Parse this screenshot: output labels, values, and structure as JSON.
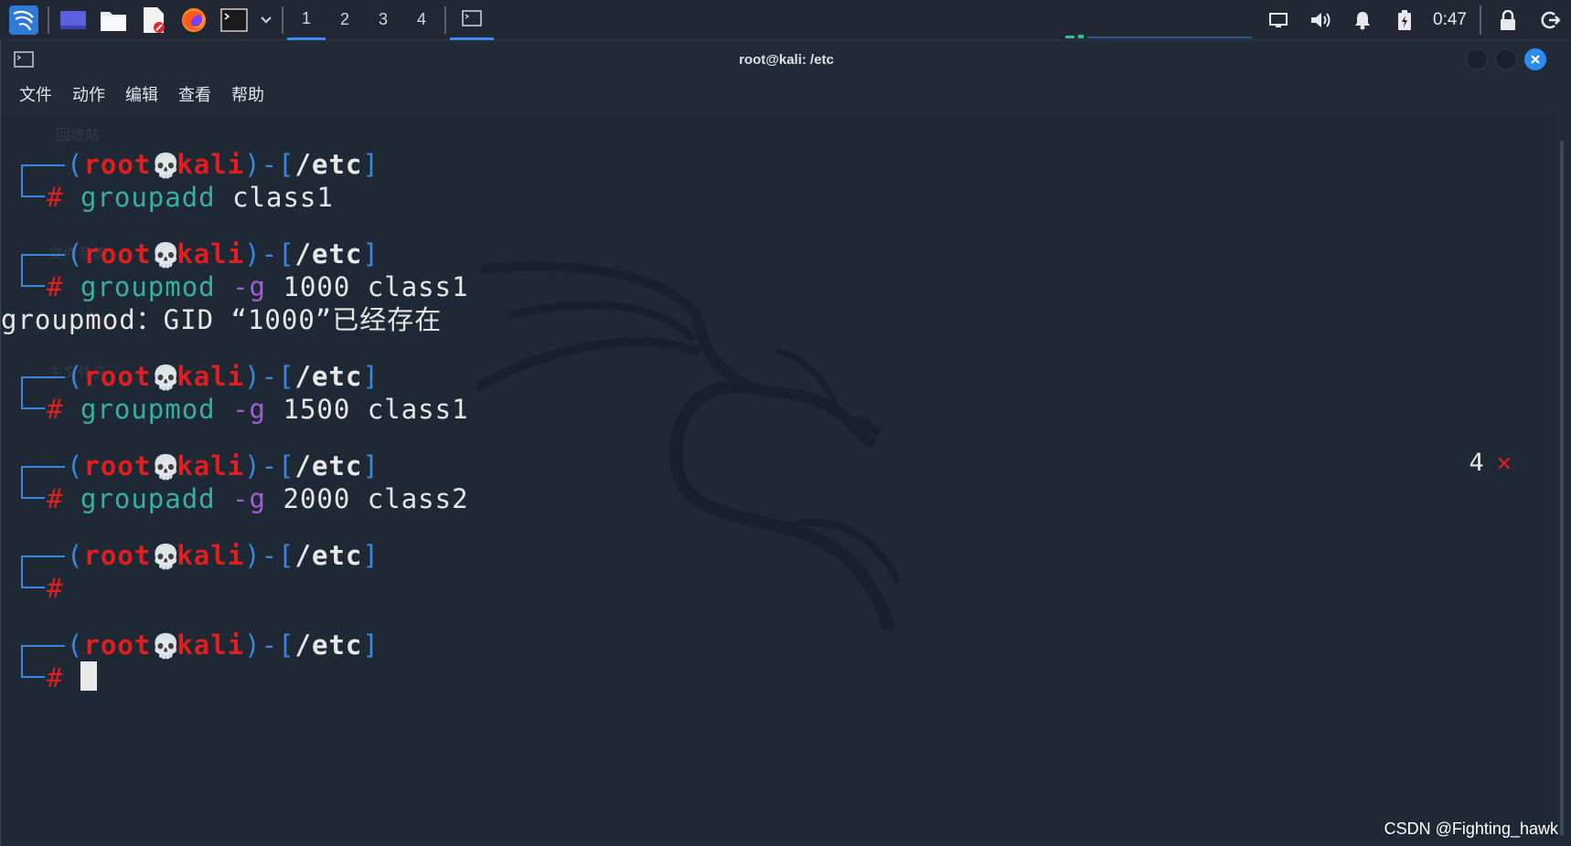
{
  "taskbar": {
    "workspaces": [
      "1",
      "2",
      "3",
      "4"
    ],
    "clock": "0:47"
  },
  "window": {
    "title": "root@kali: /etc"
  },
  "menu": [
    "文件",
    "动作",
    "编辑",
    "查看",
    "帮助"
  ],
  "prompt": {
    "open": "┌──(",
    "user": "root",
    "host": "kali",
    "close": ")-[",
    "path": "/etc",
    "end": "]",
    "hash": "#"
  },
  "terminal": {
    "blocks": [
      {
        "cmd": "groupadd",
        "opt": "",
        "args": "class1"
      },
      {
        "cmd": "groupmod",
        "opt": "-g",
        "args": "1000 class1",
        "output": "groupmod：GID “1000”已经存在"
      },
      {
        "cmd": "groupmod",
        "opt": "-g",
        "args": "1500 class1"
      },
      {
        "cmd": "groupadd",
        "opt": "-g",
        "args": "2000 class2"
      },
      {
        "cmd": "",
        "opt": "",
        "args": ""
      },
      {
        "cmd": "",
        "opt": "",
        "args": "",
        "cursor": true
      }
    ],
    "right_status": "4",
    "right_status_mark": "✕"
  },
  "desktop_ghost": [
    "回收站",
    "文件系统",
    "主文件夹"
  ],
  "watermark": "CSDN @Fighting_hawk",
  "colors": {
    "prompt_red": "#e01e1e",
    "prompt_blue": "#3a86e0",
    "command_teal": "#37b0a0",
    "option_purple": "#a05fd0",
    "accent": "#2b8cf0"
  }
}
